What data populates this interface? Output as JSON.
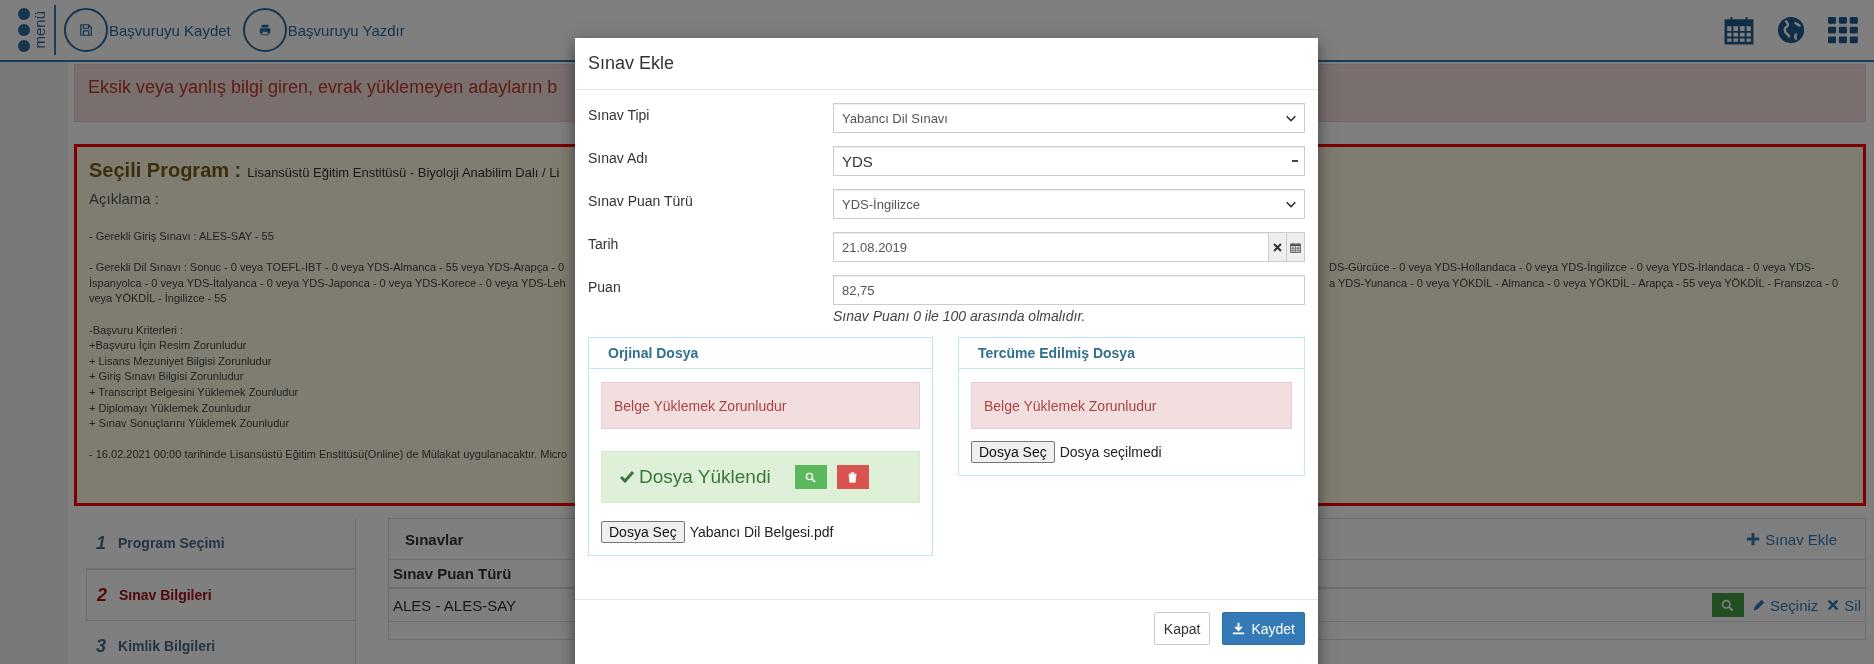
{
  "header": {
    "menu_label": "menü",
    "actions": [
      {
        "label": "Başvuruyu Kaydet"
      },
      {
        "label": "Başvuruyu Yazdır"
      }
    ]
  },
  "alert": "Eksik veya yanlış bilgi giren, evrak yüklemeyen adayların b",
  "program_box": {
    "title": "Seçili Program :",
    "program": "Lisansüstü Eğitim Enstitüsü - Biyoloji Anabilim Dalı / Li",
    "description_label": "Açıklama :",
    "paragraphs": [
      [
        {
          "left": "- Gerekli Giriş Sınavı : ALES-SAY - 55"
        }
      ],
      [
        {
          "left": "- Gerekli Dil Sınavı : Sonuc - 0 veya TOEFL-IBT - 0 veya YDS-Almanca - 55 veya YDS-Arapça - 0",
          "right": "DS-Gürcüce - 0 veya YDS-Hollandaca - 0 veya YDS-İngilizce - 0 veya YDS-İrlandaca - 0 veya YDS-"
        },
        {
          "left": "İspanyolca - 0 veya YDS-İtalyanca - 0 veya YDS-Japonca - 0 veya YDS-Korece - 0 veya YDS-Leh",
          "right": "a YDS-Yunanca - 0 veya YÖKDİL - Almanca - 0 veya YÖKDİL - Arapça - 55 veya YÖKDİL - Fransızca - 0"
        },
        {
          "left": "veya YÖKDİL - İngilizce - 55"
        }
      ],
      [
        {
          "left": "-Başvuru Kriterleri :"
        },
        {
          "left": "+Başvuru İçin Resim Zorunludur"
        },
        {
          "left": "+ Lisans Mezuniyet Bilgisi Zorunludur"
        },
        {
          "left": "+ Giriş Sınavı Bilgisi Zorunludur"
        },
        {
          "left": "+ Transcript Belgesini Yüklemek Zounludur"
        },
        {
          "left": "+ Diplomayı Yüklemek Zounludur"
        },
        {
          "left": "+ Sınav Sonuçlarını Yüklemek Zounludur"
        }
      ],
      [
        {
          "left": "- 16.02.2021 00:00 tarihinde Lisansüstü Eğitim Enstitüsü(Online) de Mülakat uygulanacaktır. Micro"
        }
      ]
    ]
  },
  "steps": [
    {
      "number": "1",
      "label": "Program Seçimi",
      "selected": false
    },
    {
      "number": "2",
      "label": "Sınav Bilgileri",
      "selected": true
    },
    {
      "number": "3",
      "label": "Kimlik Bilgileri",
      "selected": false
    }
  ],
  "exams_panel": {
    "title": "Sınavlar",
    "add_button": "Sınav Ekle",
    "columns": [
      "Sınav Puan Türü"
    ],
    "rows": [
      {
        "cells": [
          "ALES - ALES-SAY"
        ],
        "edit": "Seçiniz",
        "delete": "Sil"
      }
    ]
  },
  "modal": {
    "title": "Sınav Ekle",
    "fields": [
      {
        "kind": "select",
        "label": "Sınav Tipi",
        "value": "Yabancı Dil Sınavı"
      },
      {
        "kind": "combo",
        "label": "Sınav Adı",
        "value": "YDS"
      },
      {
        "kind": "select",
        "label": "Sınav Puan Türü",
        "value": "YDS-İngilizce"
      },
      {
        "kind": "date",
        "label": "Tarih",
        "value": "21.08.2019"
      },
      {
        "kind": "text",
        "label": "Puan",
        "value": "82,75",
        "help": "Sınav Puanı 0 ile 100 arasında olmalıdır."
      }
    ],
    "uploads": [
      {
        "title": "Orjinal Dosya",
        "error": "Belge Yüklemek Zorunludur",
        "uploaded": true,
        "uploaded_text": "Dosya Yüklendi",
        "file_button": "Dosya Seç",
        "file_name": "Yabancı Dil Belgesi.pdf"
      },
      {
        "title": "Tercüme Edilmiş Dosya",
        "error": "Belge Yüklemek Zorunludur",
        "uploaded": false,
        "file_button": "Dosya Seç",
        "file_name": "Dosya seçilmedi"
      }
    ],
    "buttons": [
      {
        "kind": "default",
        "label": "Kapat"
      },
      {
        "kind": "primary",
        "label": "Kaydet"
      }
    ]
  }
}
